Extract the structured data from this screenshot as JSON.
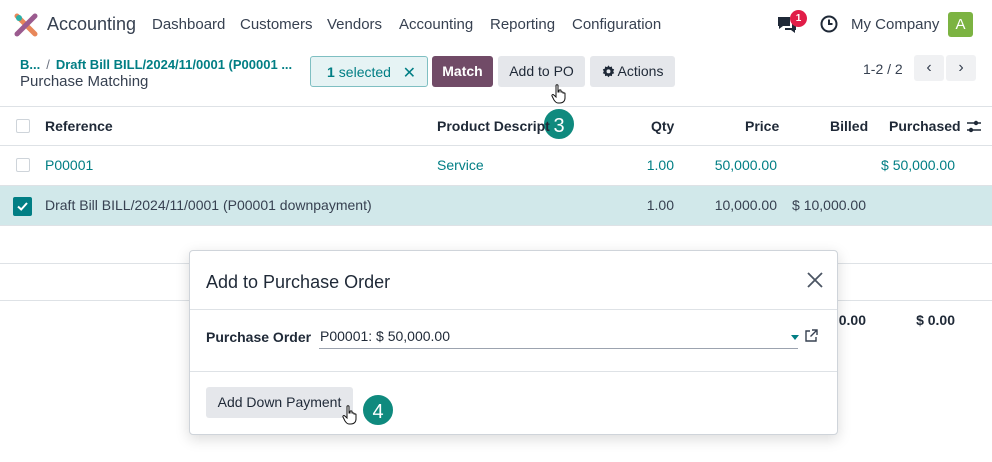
{
  "navbar": {
    "app_name": "Accounting",
    "menu": [
      "Dashboard",
      "Customers",
      "Vendors",
      "Accounting",
      "Reporting",
      "Configuration"
    ],
    "chat_count": "1",
    "company": "My Company",
    "avatar_letter": "A"
  },
  "control_panel": {
    "breadcrumb_root": "B...",
    "breadcrumb_current": "Draft Bill BILL/2024/11/0001 (P00001 ...",
    "title": "Purchase Matching",
    "selected_count": "1",
    "selected_label": "selected",
    "match_label": "Match",
    "add_to_po_label": "Add to PO",
    "actions_label": "Actions",
    "pager": "1-2 / 2"
  },
  "table": {
    "columns": [
      "Reference",
      "Product Descript",
      "Qty",
      "Price",
      "Billed",
      "Purchased"
    ],
    "rows": [
      {
        "reference": "P00001",
        "product": "Service",
        "qty": "1.00",
        "price": "50,000.00",
        "billed": "",
        "purchased": "$ 50,000.00",
        "checked": false
      },
      {
        "reference": "Draft Bill BILL/2024/11/0001 (P00001 downpayment)",
        "product": "",
        "qty": "1.00",
        "price": "10,000.00",
        "billed": "$ 10,000.00",
        "purchased": "",
        "checked": true
      }
    ],
    "totals": {
      "billed": "0.00",
      "purchased": "$ 0.00"
    }
  },
  "steps": {
    "step3": "3",
    "step4": "4"
  },
  "modal": {
    "title": "Add to Purchase Order",
    "field_label": "Purchase Order",
    "field_value": "P00001: $ 50,000.00",
    "button_label": "Add Down Payment"
  },
  "colors": {
    "accent": "#017e84",
    "primary": "#714b67",
    "step_badge": "#0f8a7e"
  }
}
